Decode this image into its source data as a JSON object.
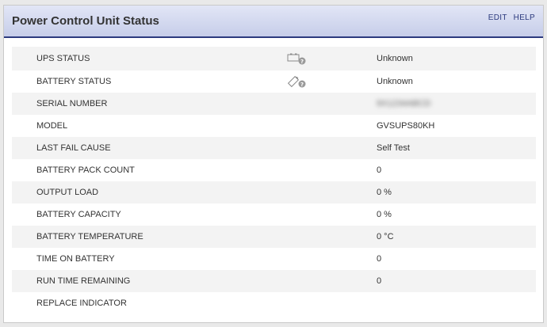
{
  "header": {
    "title": "Power Control Unit Status",
    "edit_label": "EDIT",
    "help_label": "HELP"
  },
  "rows": [
    {
      "label": "UPS STATUS",
      "value": "Unknown",
      "icon": "battery-unknown-icon"
    },
    {
      "label": "BATTERY STATUS",
      "value": "Unknown",
      "icon": "battery-tag-unknown-icon"
    },
    {
      "label": "SERIAL NUMBER",
      "value": "9X1234ABCD"
    },
    {
      "label": "MODEL",
      "value": "GVSUPS80KH"
    },
    {
      "label": "LAST FAIL CAUSE",
      "value": "Self Test"
    },
    {
      "label": "BATTERY PACK COUNT",
      "value": "0"
    },
    {
      "label": "OUTPUT LOAD",
      "value": "0 %"
    },
    {
      "label": "BATTERY CAPACITY",
      "value": "0 %"
    },
    {
      "label": "BATTERY TEMPERATURE",
      "value": "0 °C"
    },
    {
      "label": "TIME ON BATTERY",
      "value": "0"
    },
    {
      "label": "RUN TIME REMAINING",
      "value": "0"
    },
    {
      "label": "REPLACE INDICATOR",
      "value": ""
    }
  ],
  "colors": {
    "header_accent": "#2c3a7e",
    "row_alt": "#f3f3f3"
  }
}
